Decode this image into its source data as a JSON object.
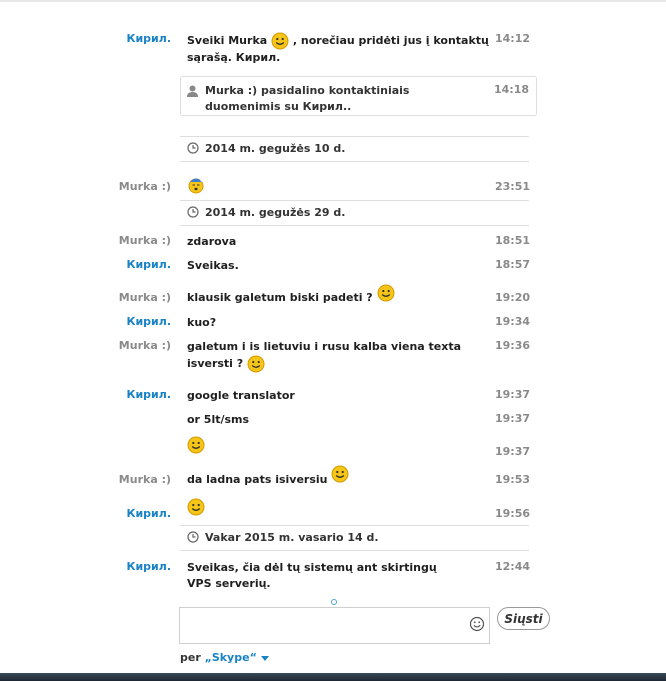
{
  "messages": [
    {
      "sender": "Кирил.",
      "text": "Sveiki Murka",
      "text2": ", norečiau pridėti jus į kontaktų sąrašą. Кирил.",
      "time": "14:12"
    },
    {
      "sender": "Murka :)",
      "time": "23:51"
    },
    {
      "sender": "Murka :)",
      "text": "zdarova",
      "time": "18:51"
    },
    {
      "sender": "Кирил.",
      "text": "Sveikas.",
      "time": "18:57"
    },
    {
      "sender": "Murka :)",
      "text": "klausik galetum biski padeti ?",
      "time": "19:20"
    },
    {
      "sender": "Кирил.",
      "text": "kuo?",
      "time": "19:34"
    },
    {
      "sender": "Murka :)",
      "text": "galetum i is lietuviu i rusu kalba viena texta isversti ?",
      "time": "19:36"
    },
    {
      "sender": "Кирил.",
      "text": "google translator",
      "time": "19:37"
    },
    {
      "text": "or 5lt/sms",
      "time": "19:37"
    },
    {
      "time": "19:37"
    },
    {
      "sender": "Murka :)",
      "text": "da ladna pats isiversiu",
      "time": "19:53"
    },
    {
      "sender": "Кирил.",
      "time": "19:56"
    },
    {
      "sender": "Кирил.",
      "text": "Sveikas, čia dėl tų sistemų ant skirtingų VPS serverių.",
      "time": "12:44"
    }
  ],
  "contact_share": {
    "text": "Murka :) pasidalino kontaktiniais duomenimis su Кирил..",
    "time": "14:18"
  },
  "dates": [
    "2014 m. gegužės 10 d.",
    "2014 m. gegužės 29 d.",
    "Vakar 2015 m. vasario 14 d."
  ],
  "composer": {
    "send_label": "Siųsti",
    "via_prefix": "per ",
    "via_brand": "„Skype“"
  },
  "colors": {
    "accent": "#1a83c6",
    "sender_other": "#8a8a8a",
    "smiley": "#f5c518"
  }
}
